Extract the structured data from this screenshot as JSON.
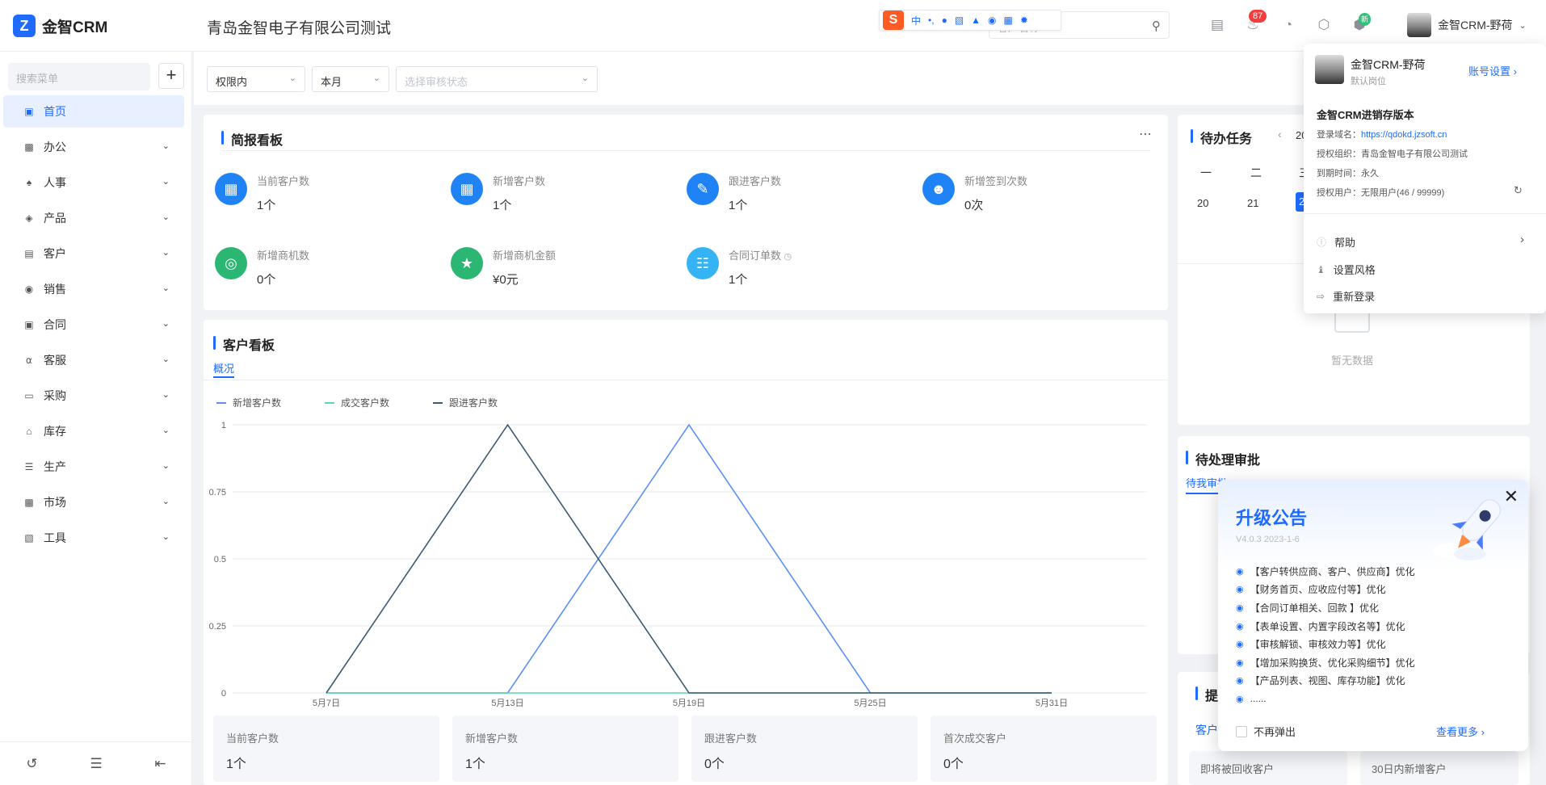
{
  "app": {
    "logo_text": "金智CRM",
    "company": "青岛金智电子有限公司测试"
  },
  "topbar": {
    "search_placeholder": "客户名称",
    "notification_count": "87",
    "new_badge": "新",
    "user_name": "金智CRM-野荷"
  },
  "ime": {
    "mode": "中"
  },
  "sidebar": {
    "search_placeholder": "搜索菜单",
    "items": [
      {
        "label": "首页",
        "icon": "home-icon",
        "active": true
      },
      {
        "label": "办公",
        "icon": "office-icon"
      },
      {
        "label": "人事",
        "icon": "hr-icon"
      },
      {
        "label": "产品",
        "icon": "product-icon"
      },
      {
        "label": "客户",
        "icon": "customer-icon"
      },
      {
        "label": "销售",
        "icon": "sales-icon"
      },
      {
        "label": "合同",
        "icon": "contract-icon"
      },
      {
        "label": "客服",
        "icon": "service-icon"
      },
      {
        "label": "采购",
        "icon": "purchase-icon"
      },
      {
        "label": "库存",
        "icon": "inventory-icon"
      },
      {
        "label": "生产",
        "icon": "production-icon"
      },
      {
        "label": "市场",
        "icon": "market-icon"
      },
      {
        "label": "工具",
        "icon": "tools-icon"
      }
    ]
  },
  "filters": {
    "scope": "权限内",
    "period": "本月",
    "audit_placeholder": "选择审核状态"
  },
  "brief_board": {
    "title": "简报看板",
    "stats": [
      {
        "label": "当前客户数",
        "value": "1个"
      },
      {
        "label": "新增客户数",
        "value": "1个"
      },
      {
        "label": "跟进客户数",
        "value": "1个"
      },
      {
        "label": "新增签到次数",
        "value": "0次"
      },
      {
        "label": "新增商机数",
        "value": "0个"
      },
      {
        "label": "新增商机金额",
        "value": "¥0元"
      },
      {
        "label": "合同订单数",
        "value": "1个"
      }
    ]
  },
  "customer_board": {
    "title": "客户看板",
    "tab": "概况",
    "cards": [
      {
        "label": "当前客户数",
        "value": "1个"
      },
      {
        "label": "新增客户数",
        "value": "1个"
      },
      {
        "label": "跟进客户数",
        "value": "0个"
      },
      {
        "label": "首次成交客户",
        "value": "0个"
      }
    ]
  },
  "chart_data": {
    "type": "line",
    "x": [
      "5月7日",
      "5月13日",
      "5月19日",
      "5月25日",
      "5月31日"
    ],
    "ylim": [
      0,
      1
    ],
    "yticks": [
      "0",
      "0.25",
      "0.5",
      "0.75",
      "1"
    ],
    "series": [
      {
        "name": "新增客户数",
        "color": "#5b8ff9",
        "points": [
          [
            0,
            0
          ],
          [
            1,
            0
          ],
          [
            2,
            1
          ],
          [
            3,
            0
          ],
          [
            4,
            0
          ]
        ]
      },
      {
        "name": "成交客户数",
        "color": "#5ad8a6",
        "points": [
          [
            0,
            0
          ],
          [
            1,
            0
          ],
          [
            2,
            0
          ],
          [
            3,
            0
          ],
          [
            4,
            0
          ]
        ]
      },
      {
        "name": "跟进客户数",
        "color": "#3c5a78",
        "points": [
          [
            0,
            0
          ],
          [
            1,
            1
          ],
          [
            2,
            0
          ],
          [
            3,
            0
          ],
          [
            4,
            0
          ]
        ]
      }
    ]
  },
  "todo": {
    "title": "待办任务",
    "year_fragment": "20",
    "weekdays": [
      "一",
      "二",
      "三"
    ],
    "days": [
      "20",
      "21",
      "2"
    ],
    "empty_text": "暂无数据"
  },
  "approval": {
    "title": "待处理审批",
    "tab_active": "待我审批"
  },
  "reminder": {
    "title": "提",
    "tab": "客户",
    "cards": [
      "即将被回收客户",
      "30日内新增客户"
    ]
  },
  "account_dropdown": {
    "user_name": "金智CRM-野荷",
    "position": "默认岗位",
    "settings_link": "账号设置",
    "version": "金智CRM进销存版本",
    "domain_label": "登录域名：",
    "domain": "https://qdokd.jzsoft.cn",
    "org": "授权组织：青岛金智电子有限公司测试",
    "expire": "到期时间：永久",
    "users": "授权用户：无限用户(46 / 99999)",
    "menu": [
      {
        "label": "帮助",
        "icon": "help-icon"
      },
      {
        "label": "设置风格",
        "icon": "style-icon"
      },
      {
        "label": "重新登录",
        "icon": "logout-icon"
      }
    ]
  },
  "upgrade_notice": {
    "title": "升级公告",
    "version": "V4.0.3 2023-1-6",
    "items": [
      "【客户转供应商、客户、供应商】优化",
      "【财务首页、应收应付等】优化",
      "【合同订单相关、回款 】优化",
      "【表单设置、内置字段改名等】优化",
      "【审核解锁、审核效力等】优化",
      "【增加采购换货、优化采购细节】优化",
      "【产品列表、视图、库存功能】优化",
      "......"
    ],
    "dont_show": "不再弹出",
    "more": "查看更多"
  }
}
